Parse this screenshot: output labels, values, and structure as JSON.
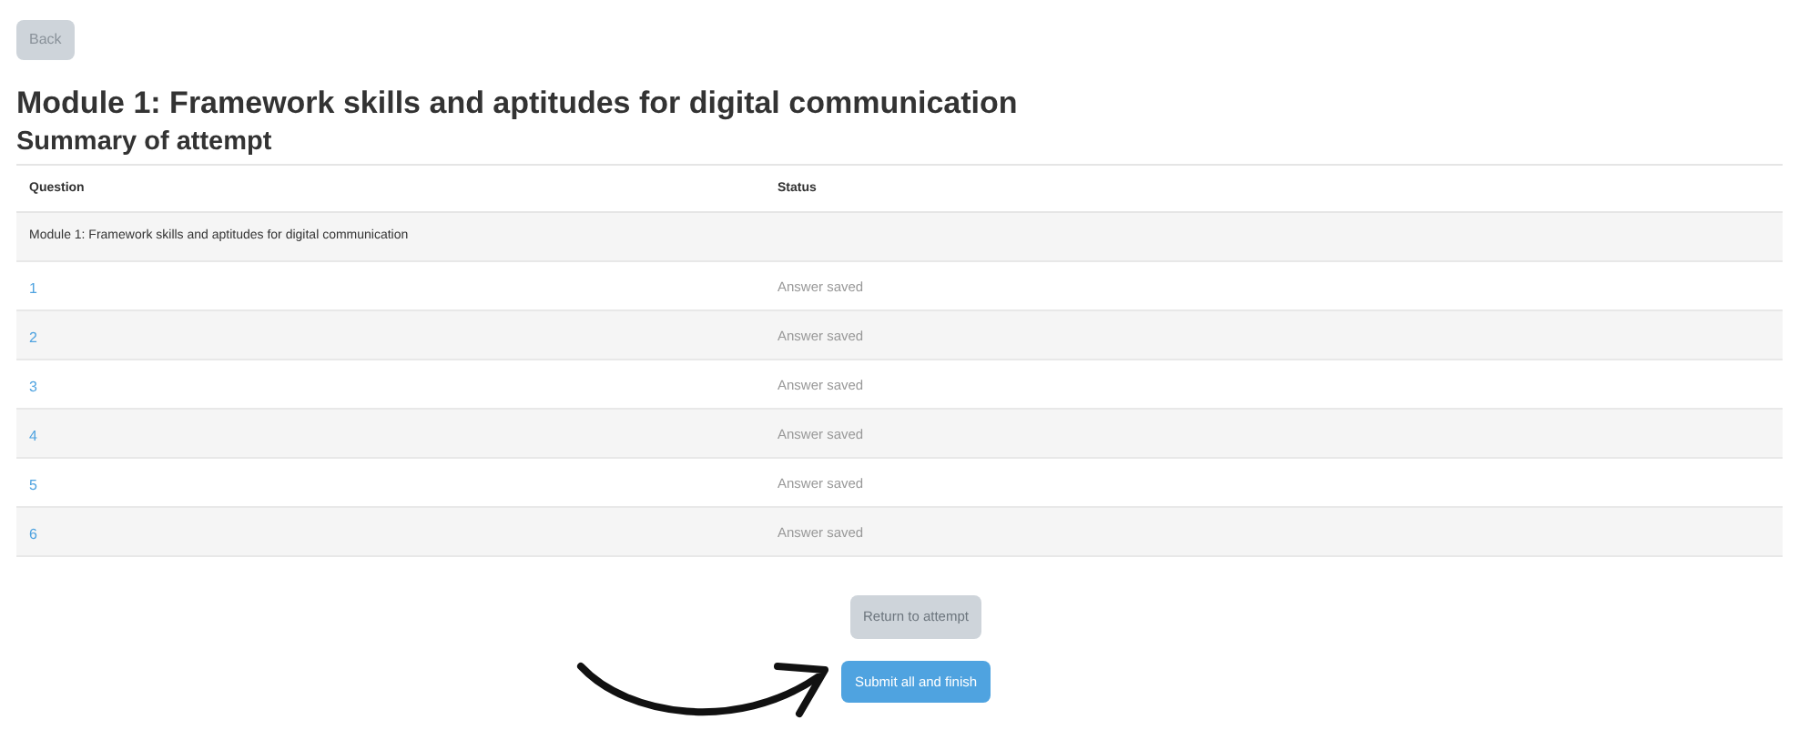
{
  "back_button": "Back",
  "title": "Module 1: Framework skills and aptitudes for digital communication",
  "subtitle": "Summary of attempt",
  "table": {
    "columns": [
      "Question",
      "Status"
    ],
    "section": "Module 1: Framework skills and aptitudes for digital communication",
    "rows": [
      {
        "question": "1",
        "status": "Answer saved"
      },
      {
        "question": "2",
        "status": "Answer saved"
      },
      {
        "question": "3",
        "status": "Answer saved"
      },
      {
        "question": "4",
        "status": "Answer saved"
      },
      {
        "question": "5",
        "status": "Answer saved"
      },
      {
        "question": "6",
        "status": "Answer saved"
      }
    ]
  },
  "buttons": [
    {
      "label": "Return to attempt",
      "kind": "secondary"
    },
    {
      "label": "Submit all and finish",
      "kind": "primary"
    }
  ]
}
